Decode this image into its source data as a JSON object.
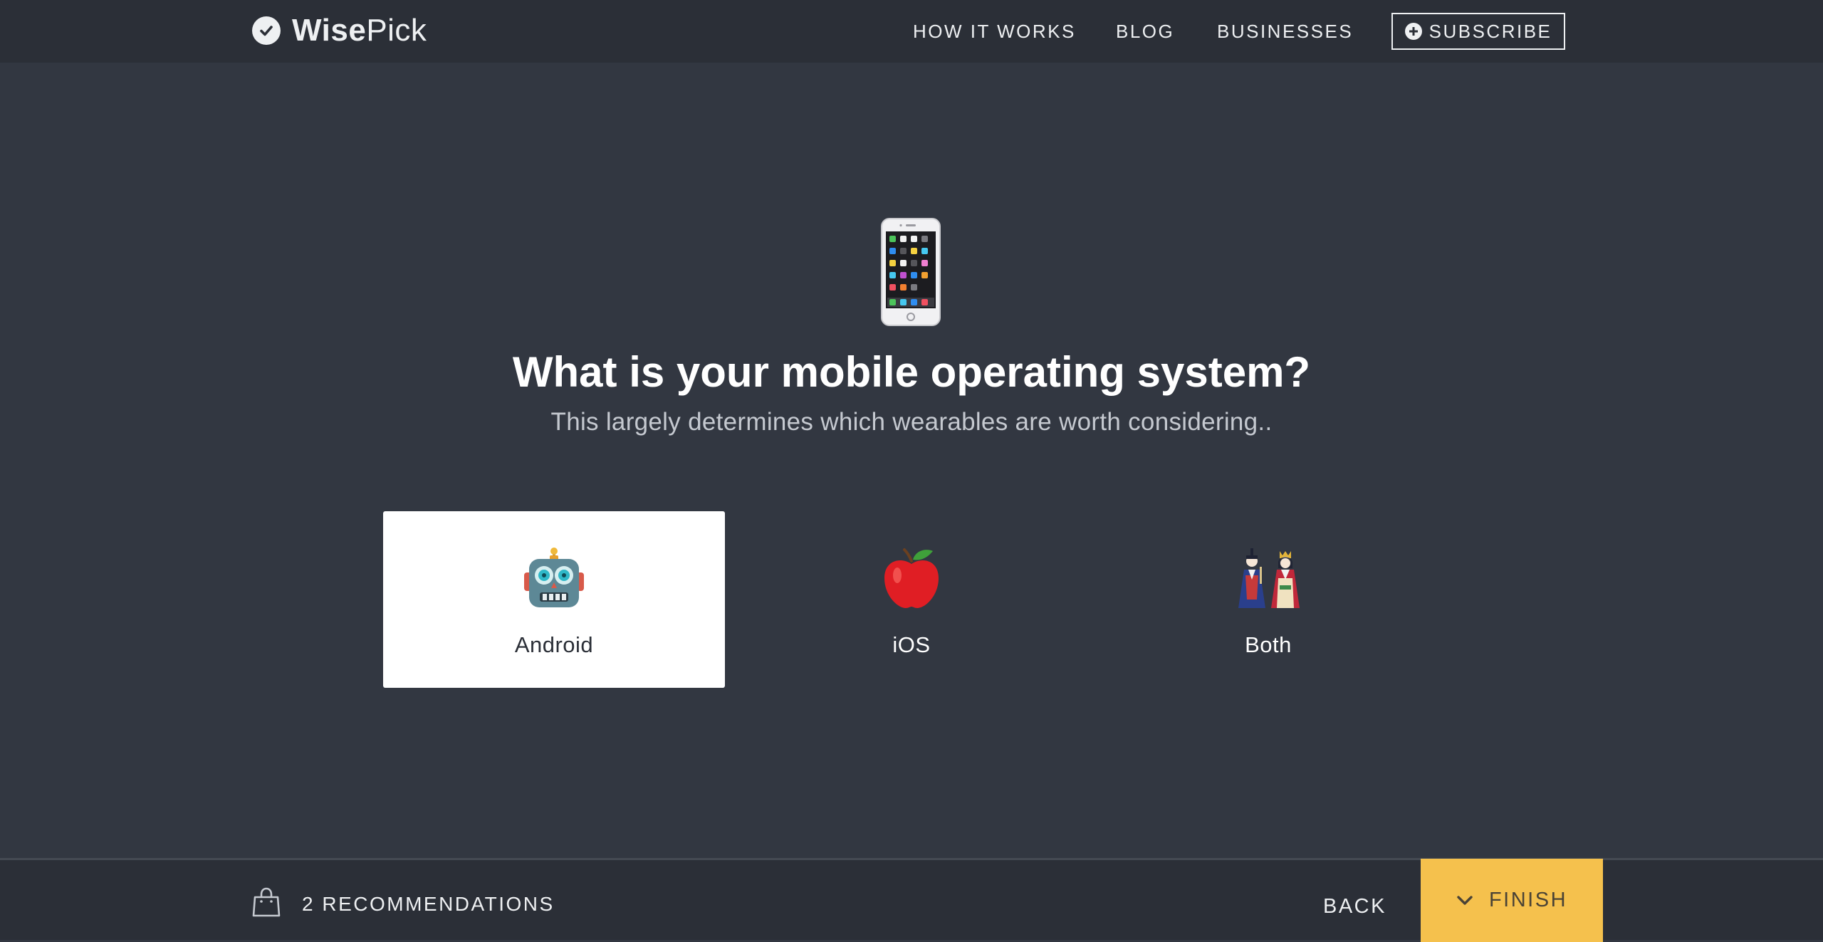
{
  "header": {
    "brand_bold": "Wise",
    "brand_regular": "Pick",
    "nav": {
      "how_it_works": "HOW IT WORKS",
      "blog": "BLOG",
      "businesses": "BUSINESSES"
    },
    "subscribe_label": "SUBSCRIBE"
  },
  "question": {
    "icon": "mobile-phone-icon",
    "title": "What is your mobile operating system?",
    "subtitle": "This largely determines which wearables are worth considering.."
  },
  "options": [
    {
      "label": "Android",
      "icon": "robot-icon",
      "selected": true
    },
    {
      "label": "iOS",
      "icon": "red-apple-icon",
      "selected": false
    },
    {
      "label": "Both",
      "icon": "dolls-icon",
      "selected": false
    }
  ],
  "footer": {
    "recommendations_label": "2 RECOMMENDATIONS",
    "back_label": "BACK",
    "finish_label": "FINISH"
  },
  "colors": {
    "background": "#323741",
    "header_bg": "#2b2f37",
    "accent": "#f5c14d",
    "selected_card": "#ffffff"
  }
}
